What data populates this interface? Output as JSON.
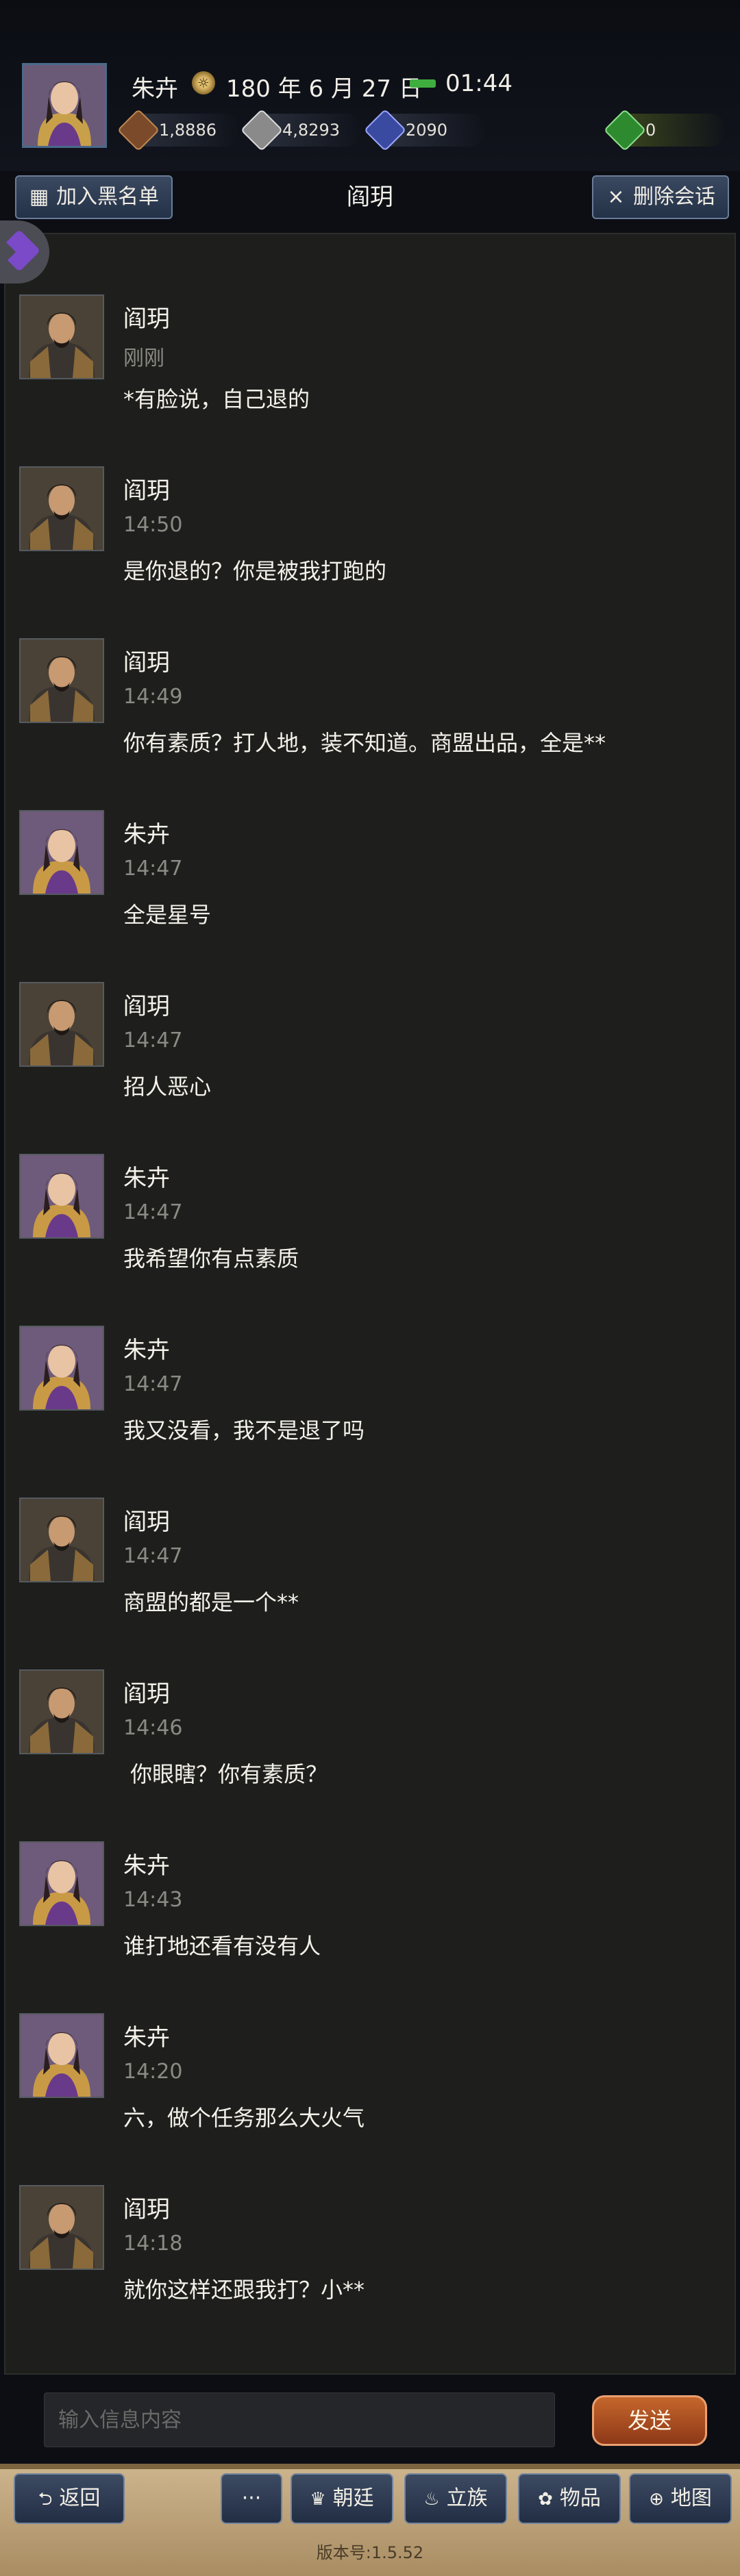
{
  "player": {
    "name": "朱卉",
    "date": "180 年 6 月 27 日",
    "time": "01:44",
    "resources": [
      {
        "icon": "copper-coin-icon",
        "value": "1,8886"
      },
      {
        "icon": "silver-ingot-icon",
        "value": "4,8293"
      },
      {
        "icon": "sword-medal-icon",
        "value": "2090"
      },
      {
        "icon": "money-bag-icon",
        "value": "0"
      }
    ]
  },
  "header": {
    "blacklist_label": "加入黑名单",
    "title": "阎玥",
    "delete_label": "删除会话"
  },
  "messages": [
    {
      "sender": "阎玥",
      "time": "刚刚",
      "text": "*有脸说，自己退的"
    },
    {
      "sender": "阎玥",
      "time": "14:50",
      "text": "是你退的？你是被我打跑的"
    },
    {
      "sender": "阎玥",
      "time": "14:49",
      "text": "你有素质？打人地，装不知道。商盟出品，全是**"
    },
    {
      "sender": "朱卉",
      "time": "14:47",
      "text": "全是星号"
    },
    {
      "sender": "阎玥",
      "time": "14:47",
      "text": "招人恶心"
    },
    {
      "sender": "朱卉",
      "time": "14:47",
      "text": "我希望你有点素质"
    },
    {
      "sender": "朱卉",
      "time": "14:47",
      "text": "我又没看，我不是退了吗"
    },
    {
      "sender": "阎玥",
      "time": "14:47",
      "text": "商盟的都是一个**"
    },
    {
      "sender": "阎玥",
      "time": "14:46",
      "text": " 你眼瞎？你有素质？"
    },
    {
      "sender": "朱卉",
      "time": "14:43",
      "text": "谁打地还看有没有人"
    },
    {
      "sender": "朱卉",
      "time": "14:20",
      "text": "六，做个任务那么大火气"
    },
    {
      "sender": "阎玥",
      "time": "14:18",
      "text": "就你这样还跟我打？小**"
    }
  ],
  "composer": {
    "placeholder": "输入信息内容",
    "send_label": "发送"
  },
  "nav": {
    "back": "返回",
    "more": "···",
    "court": "朝廷",
    "clan": "立族",
    "items": "物品",
    "map": "地图",
    "version": "版本号:1.5.52"
  }
}
